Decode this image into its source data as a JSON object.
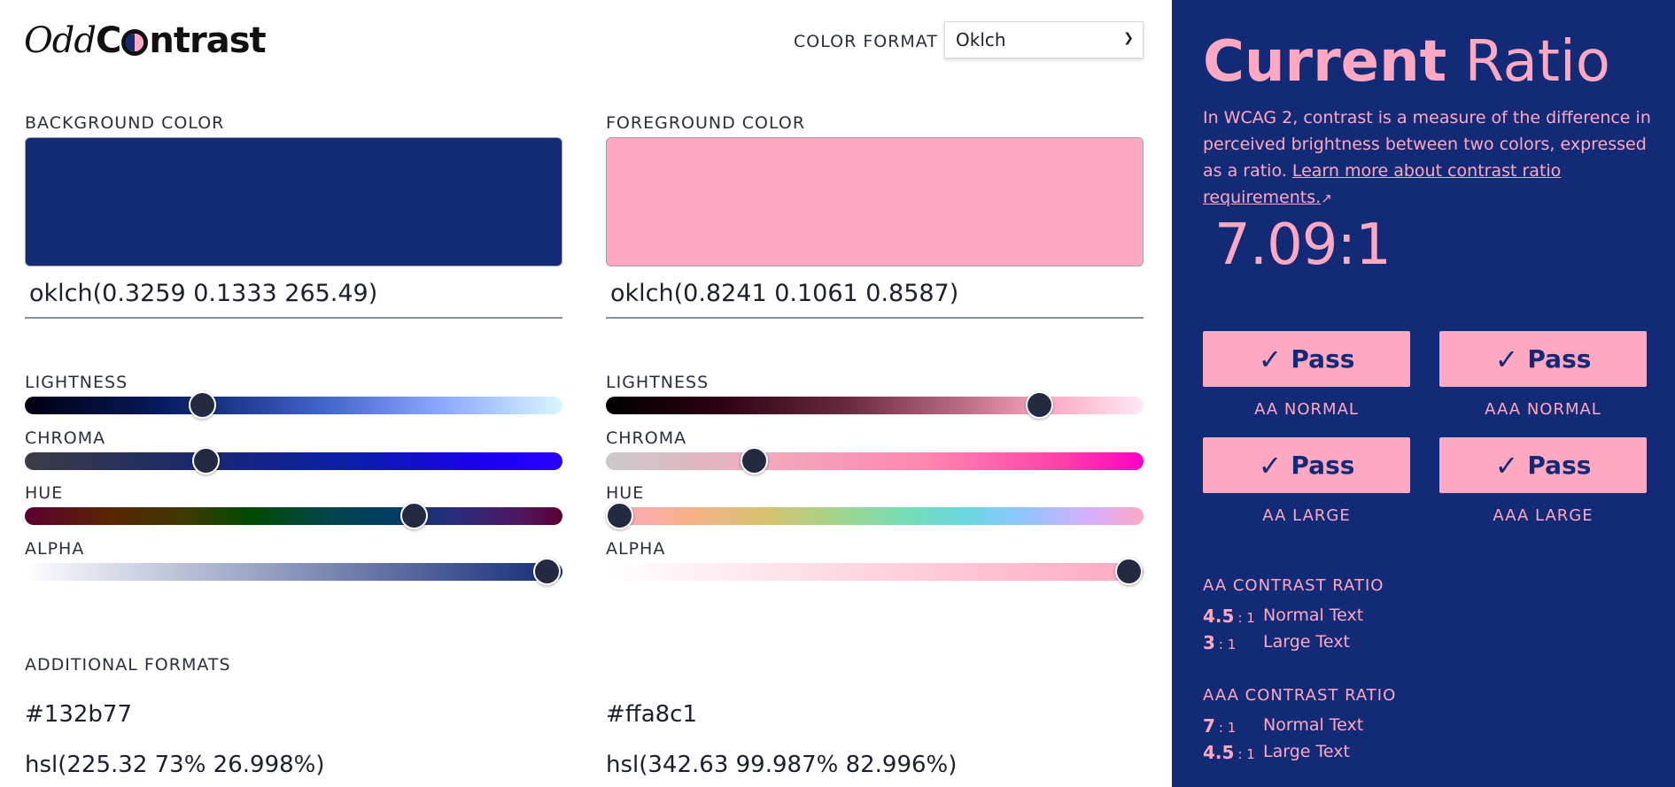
{
  "app": {
    "logo_part1": "Odd",
    "logo_part2_prefix": "C",
    "logo_part2_suffix": "ntrast"
  },
  "header": {
    "format_label": "COLOR FORMAT",
    "format_value": "Oklch"
  },
  "background": {
    "label": "BACKGROUND COLOR",
    "value": "oklch(0.3259 0.1333 265.49)",
    "swatch_color": "#132b77",
    "sliders": [
      {
        "label": "LIGHTNESS",
        "percent": 33
      },
      {
        "label": "CHROMA",
        "percent": 34
      },
      {
        "label": "HUE",
        "percent": 73
      },
      {
        "label": "ALPHA",
        "percent": 100
      }
    ],
    "formats": [
      "#132b77",
      "hsl(225.32 73% 26.998%)"
    ]
  },
  "foreground": {
    "label": "FOREGROUND COLOR",
    "value": "oklch(0.8241 0.1061 0.8587)",
    "swatch_color": "#ffa8c1",
    "sliders": [
      {
        "label": "LIGHTNESS",
        "percent": 81
      },
      {
        "label": "CHROMA",
        "percent": 27
      },
      {
        "label": "HUE",
        "percent": 0
      },
      {
        "label": "ALPHA",
        "percent": 100
      }
    ],
    "formats": [
      "#ffa8c1",
      "hsl(342.63 99.987% 82.996%)"
    ]
  },
  "additional_formats_label": "ADDITIONAL FORMATS",
  "panel": {
    "title_bold": "Current",
    "title_light": "Ratio",
    "description": "In WCAG 2, contrast is a measure of the difference in perceived brightness between two colors, expressed as a ratio.",
    "link_text": "Learn more about contrast ratio requirements.",
    "ratio": "7.09:1",
    "results": [
      {
        "status": "Pass",
        "caption": "AA NORMAL"
      },
      {
        "status": "Pass",
        "caption": "AAA NORMAL"
      },
      {
        "status": "Pass",
        "caption": "AA LARGE"
      },
      {
        "status": "Pass",
        "caption": "AAA LARGE"
      }
    ],
    "aa_heading": "AA CONTRAST RATIO",
    "aa_rows": [
      {
        "num": "4.5",
        "sep": ": 1",
        "text": "Normal Text"
      },
      {
        "num": "3",
        "sep": ": 1",
        "text": "Large Text"
      }
    ],
    "aaa_heading": "AAA CONTRAST RATIO",
    "aaa_rows": [
      {
        "num": "7",
        "sep": ": 1",
        "text": "Normal Text"
      },
      {
        "num": "4.5",
        "sep": ": 1",
        "text": "Large Text"
      }
    ]
  },
  "colors": {
    "panel_bg": "#132b77",
    "accent_pink": "#ffa8c1",
    "thumb": "#252a44"
  }
}
